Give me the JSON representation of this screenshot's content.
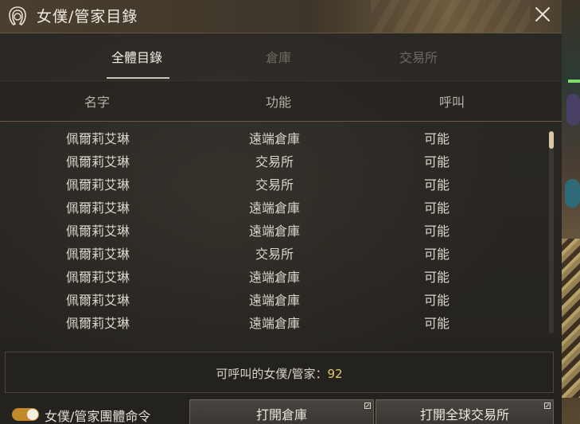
{
  "window": {
    "title": "女僕/管家目錄"
  },
  "tabs": [
    {
      "label": "全體目錄",
      "active": true
    },
    {
      "label": "倉庫",
      "active": false
    },
    {
      "label": "交易所",
      "active": false
    }
  ],
  "columns": [
    "名字",
    "功能",
    "呼叫"
  ],
  "rows": [
    {
      "name": "佩爾莉艾琳",
      "function": "遠端倉庫",
      "call": "可能"
    },
    {
      "name": "佩爾莉艾琳",
      "function": "交易所",
      "call": "可能"
    },
    {
      "name": "佩爾莉艾琳",
      "function": "交易所",
      "call": "可能"
    },
    {
      "name": "佩爾莉艾琳",
      "function": "遠端倉庫",
      "call": "可能"
    },
    {
      "name": "佩爾莉艾琳",
      "function": "遠端倉庫",
      "call": "可能"
    },
    {
      "name": "佩爾莉艾琳",
      "function": "交易所",
      "call": "可能"
    },
    {
      "name": "佩爾莉艾琳",
      "function": "遠端倉庫",
      "call": "可能"
    },
    {
      "name": "佩爾莉艾琳",
      "function": "遠端倉庫",
      "call": "可能"
    },
    {
      "name": "佩爾莉艾琳",
      "function": "遠端倉庫",
      "call": "可能"
    }
  ],
  "summary": {
    "label": "可呼叫的女僕/管家：",
    "count": "92"
  },
  "footer": {
    "toggle_label": "女僕/管家團體命令",
    "toggle_on": true,
    "open_storage_label": "打開倉庫",
    "open_market_label": "打開全球交易所"
  },
  "colors": {
    "accent": "#c08a2a",
    "count": "#e8c76a"
  },
  "icons": {
    "title": "maid-icon",
    "close": "close-icon",
    "popout": "popout-icon"
  }
}
